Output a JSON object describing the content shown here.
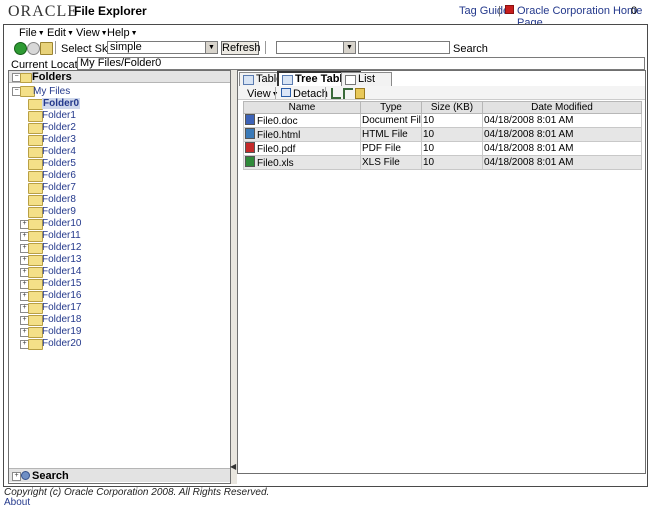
{
  "header": {
    "logo_text": "ORACLE",
    "app_title": "File Explorer",
    "tag_guide": "Tag Guide",
    "separator": "|",
    "home_link": "Oracle Corporation Home Page",
    "trailing": "0"
  },
  "menubar": {
    "items": [
      {
        "label": "File"
      },
      {
        "label": "Edit"
      },
      {
        "label": "View"
      },
      {
        "label": "Help"
      }
    ]
  },
  "toolbar": {
    "skin_label": "Select Skin",
    "skin_value": "simple",
    "refresh_label": "Refresh",
    "search_label": "Search",
    "search_value": ""
  },
  "location": {
    "label": "Current Location:",
    "value": "My Files/Folder0"
  },
  "left_panel": {
    "folders_title": "Folders",
    "root_label": "My Files",
    "selected_folder": "Folder0",
    "folders": [
      "Folder1",
      "Folder2",
      "Folder3",
      "Folder4",
      "Folder5",
      "Folder6",
      "Folder7",
      "Folder8",
      "Folder9"
    ],
    "expandable_folders": [
      "Folder10",
      "Folder11",
      "Folder12",
      "Folder13",
      "Folder14",
      "Folder15",
      "Folder16",
      "Folder17",
      "Folder18",
      "Folder19",
      "Folder20"
    ],
    "search_title": "Search"
  },
  "right_panel": {
    "tabs": [
      {
        "label": "Table"
      },
      {
        "label": "Tree Table"
      },
      {
        "label": "List"
      }
    ],
    "view_menu": "View",
    "detach": "Detach",
    "columns": [
      "Name",
      "Type",
      "Size (KB)",
      "Date Modified"
    ],
    "rows": [
      {
        "name": "File0.doc",
        "type": "Document File",
        "size": "10",
        "date": "04/18/2008 8:01 AM",
        "icon": "doc-icon"
      },
      {
        "name": "File0.html",
        "type": "HTML File",
        "size": "10",
        "date": "04/18/2008 8:01 AM",
        "icon": "html-icon"
      },
      {
        "name": "File0.pdf",
        "type": "PDF File",
        "size": "10",
        "date": "04/18/2008 8:01 AM",
        "icon": "pdf-icon"
      },
      {
        "name": "File0.xls",
        "type": "XLS File",
        "size": "10",
        "date": "04/18/2008 8:01 AM",
        "icon": "xls-icon"
      }
    ]
  },
  "footer": {
    "copyright": "Copyright (c) Oracle Corporation 2008. All Rights Reserved.",
    "about": "About"
  },
  "colors": {
    "link": "#24398c",
    "accent_red": "#c61d1d",
    "folder_yellow": "#f4e088"
  }
}
